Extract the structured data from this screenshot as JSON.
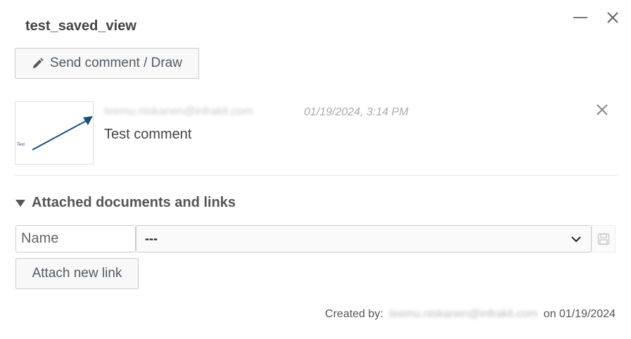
{
  "window": {
    "title": "test_saved_view",
    "minimize_icon": "minimize-icon",
    "close_icon": "close-icon"
  },
  "toolbar": {
    "send_label": "Send comment / Draw",
    "send_icon": "pencil-icon"
  },
  "comment": {
    "thumbnail_text": "Test",
    "author": "teemu.niskanen@infrakit.com",
    "date": "01/19/2024, 3:14 PM",
    "text": "Test comment"
  },
  "attachments": {
    "heading": "Attached documents and links",
    "name_placeholder": "Name",
    "select_value": "---",
    "attach_label": "Attach new link"
  },
  "footer": {
    "created_by_label": "Created by:",
    "created_by_user": "teemu.niskanen@infrakit.com",
    "on_label": "on",
    "created_date": "01/19/2024"
  },
  "colors": {
    "arrow": "#1f4e7a",
    "button_text": "#505a66"
  }
}
